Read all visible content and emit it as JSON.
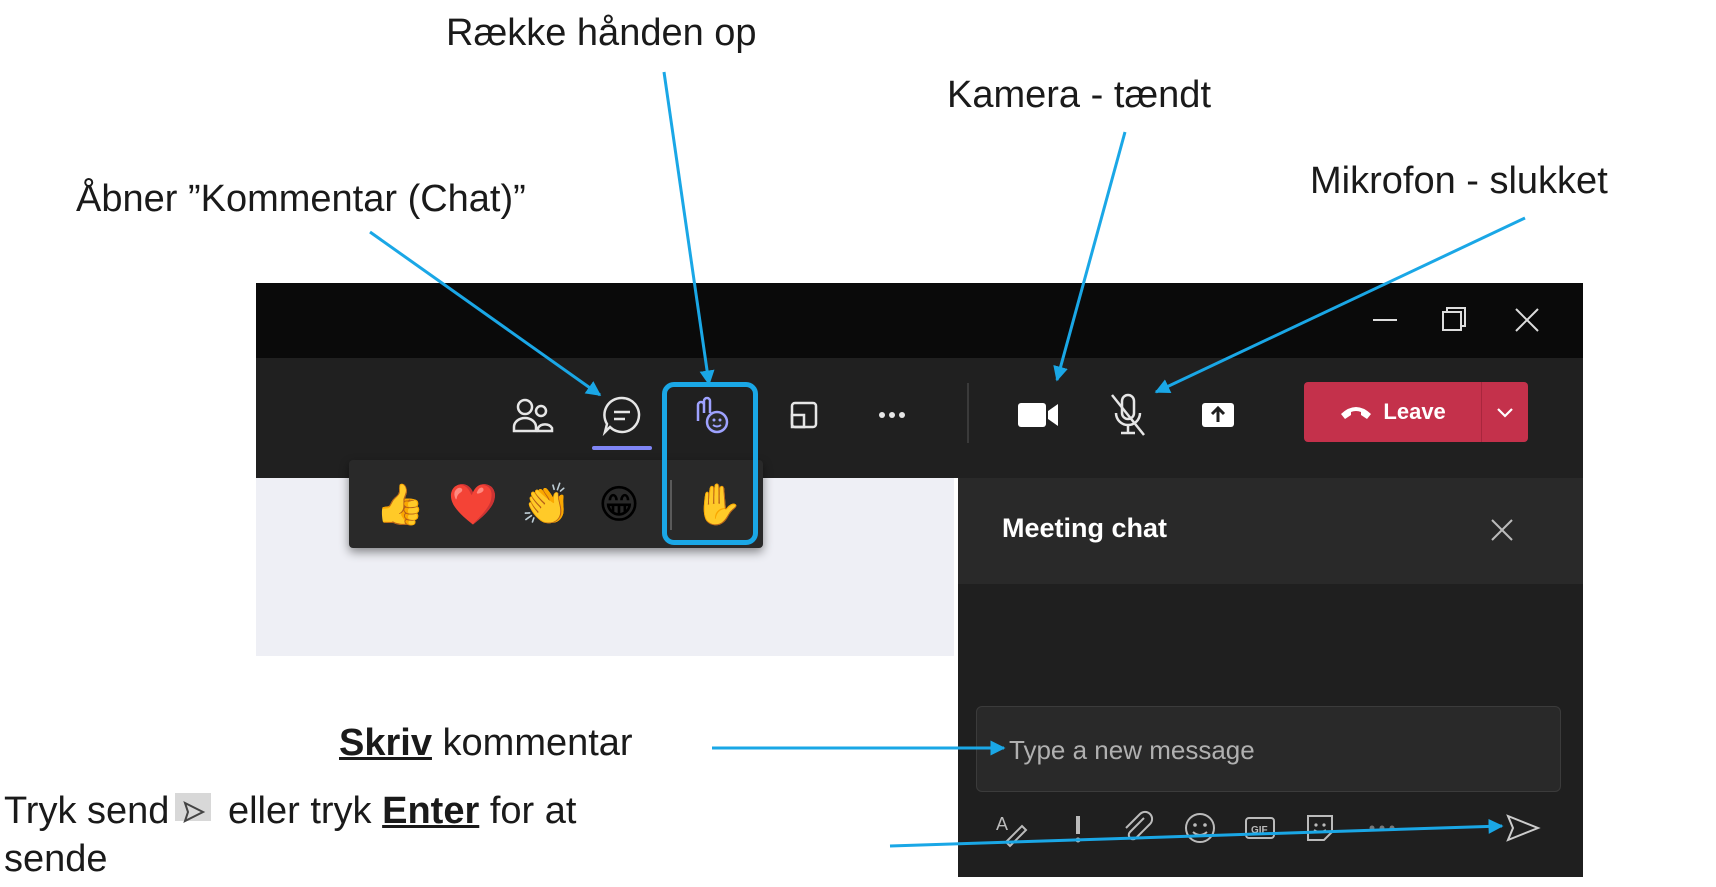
{
  "annotations": {
    "raise_hand": "Række hånden op",
    "camera": "Kamera - tændt",
    "open_chat": "Åbner ”Kommentar (Chat)”",
    "microphone": "Mikrofon - slukket",
    "write_bold": "Skriv",
    "write_rest": " kommentar",
    "send_part1": "Tryk send",
    "send_part2": " eller tryk ",
    "send_enter": "Enter",
    "send_part3": " for at",
    "send_line2": "sende"
  },
  "toolbar": {
    "leave_label": "Leave",
    "buttons": [
      "people-icon",
      "chat-icon",
      "reactions-icon",
      "share-tray-icon",
      "more-icon",
      "camera-icon",
      "mic-off-icon",
      "share-icon"
    ]
  },
  "reactions": {
    "items": [
      "👍",
      "❤️",
      "👏",
      "😁",
      "✋"
    ]
  },
  "chat": {
    "title": "Meeting chat",
    "placeholder": "Type a new message",
    "compose_icons": [
      "format-icon",
      "important-icon",
      "attach-icon",
      "emoji-icon",
      "gif-icon",
      "sticker-icon",
      "more-icon",
      "send-icon"
    ]
  },
  "colors": {
    "highlight": "#1aa7e6",
    "leave": "#c4314b",
    "accent": "#7f85f5",
    "toolbar_bg": "#202020"
  }
}
